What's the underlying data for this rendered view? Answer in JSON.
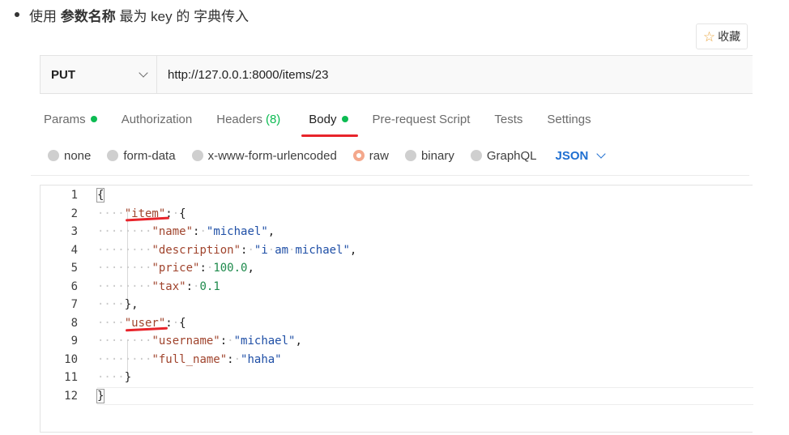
{
  "article": {
    "bullet_segments": [
      {
        "text": "使用 ",
        "bold": false
      },
      {
        "text": "参数名称",
        "bold": true
      },
      {
        "text": " 最为 key 的 字典传入",
        "bold": false
      }
    ],
    "favorite_label": "收藏"
  },
  "request": {
    "method": "PUT",
    "url": "http://127.0.0.1:8000/items/23"
  },
  "tabs": [
    {
      "label": "Params",
      "dot": true,
      "count": ""
    },
    {
      "label": "Authorization",
      "dot": false,
      "count": ""
    },
    {
      "label": "Headers",
      "dot": false,
      "count": "(8)"
    },
    {
      "label": "Body",
      "dot": true,
      "count": "",
      "active": true
    },
    {
      "label": "Pre-request Script",
      "dot": false,
      "count": ""
    },
    {
      "label": "Tests",
      "dot": false,
      "count": ""
    },
    {
      "label": "Settings",
      "dot": false,
      "count": ""
    }
  ],
  "body_options": [
    "none",
    "form-data",
    "x-www-form-urlencoded",
    "raw",
    "binary",
    "GraphQL"
  ],
  "body_selected": "raw",
  "raw_type": "JSON",
  "code_lines": [
    {
      "no": "1",
      "tokens": [
        {
          "t": "{",
          "c": "p"
        }
      ]
    },
    {
      "no": "2",
      "tokens": [
        {
          "t": "····",
          "c": "ws"
        },
        {
          "t": "\"item\"",
          "c": "key"
        },
        {
          "t": ":",
          "c": "p"
        },
        {
          "t": "·",
          "c": "ws"
        },
        {
          "t": "{",
          "c": "p"
        }
      ]
    },
    {
      "no": "3",
      "tokens": [
        {
          "t": "········",
          "c": "ws"
        },
        {
          "t": "\"name\"",
          "c": "key"
        },
        {
          "t": ":",
          "c": "p"
        },
        {
          "t": "·",
          "c": "ws"
        },
        {
          "t": "\"michael\"",
          "c": "str"
        },
        {
          "t": ",",
          "c": "p"
        }
      ]
    },
    {
      "no": "4",
      "tokens": [
        {
          "t": "········",
          "c": "ws"
        },
        {
          "t": "\"description\"",
          "c": "key"
        },
        {
          "t": ":",
          "c": "p"
        },
        {
          "t": "·",
          "c": "ws"
        },
        {
          "t": "\"i",
          "c": "str"
        },
        {
          "t": "·",
          "c": "ws"
        },
        {
          "t": "am",
          "c": "str"
        },
        {
          "t": "·",
          "c": "ws"
        },
        {
          "t": "michael\"",
          "c": "str"
        },
        {
          "t": ",",
          "c": "p"
        }
      ]
    },
    {
      "no": "5",
      "tokens": [
        {
          "t": "········",
          "c": "ws"
        },
        {
          "t": "\"price\"",
          "c": "key"
        },
        {
          "t": ":",
          "c": "p"
        },
        {
          "t": "·",
          "c": "ws"
        },
        {
          "t": "100.0",
          "c": "num"
        },
        {
          "t": ",",
          "c": "p"
        }
      ]
    },
    {
      "no": "6",
      "tokens": [
        {
          "t": "········",
          "c": "ws"
        },
        {
          "t": "\"tax\"",
          "c": "key"
        },
        {
          "t": ":",
          "c": "p"
        },
        {
          "t": "·",
          "c": "ws"
        },
        {
          "t": "0.1",
          "c": "num"
        }
      ]
    },
    {
      "no": "7",
      "tokens": [
        {
          "t": "····",
          "c": "ws"
        },
        {
          "t": "},",
          "c": "p"
        }
      ]
    },
    {
      "no": "8",
      "tokens": [
        {
          "t": "····",
          "c": "ws"
        },
        {
          "t": "\"user\"",
          "c": "key"
        },
        {
          "t": ":",
          "c": "p"
        },
        {
          "t": "·",
          "c": "ws"
        },
        {
          "t": "{",
          "c": "p"
        }
      ]
    },
    {
      "no": "9",
      "tokens": [
        {
          "t": "········",
          "c": "ws"
        },
        {
          "t": "\"username\"",
          "c": "key"
        },
        {
          "t": ":",
          "c": "p"
        },
        {
          "t": "·",
          "c": "ws"
        },
        {
          "t": "\"michael\"",
          "c": "str"
        },
        {
          "t": ",",
          "c": "p"
        }
      ]
    },
    {
      "no": "10",
      "tokens": [
        {
          "t": "········",
          "c": "ws"
        },
        {
          "t": "\"full_name\"",
          "c": "key"
        },
        {
          "t": ":",
          "c": "p"
        },
        {
          "t": "·",
          "c": "ws"
        },
        {
          "t": "\"haha\"",
          "c": "str"
        }
      ]
    },
    {
      "no": "11",
      "tokens": [
        {
          "t": "····",
          "c": "ws"
        },
        {
          "t": "}",
          "c": "p"
        }
      ]
    },
    {
      "no": "12",
      "tokens": [
        {
          "t": "}",
          "c": "p"
        }
      ]
    }
  ],
  "colors": {
    "accent_green": "#0cbb52",
    "json_blue": "#1f6fd1",
    "annotation_red": "#e8242b",
    "radio_orange": "#f4a88c"
  }
}
